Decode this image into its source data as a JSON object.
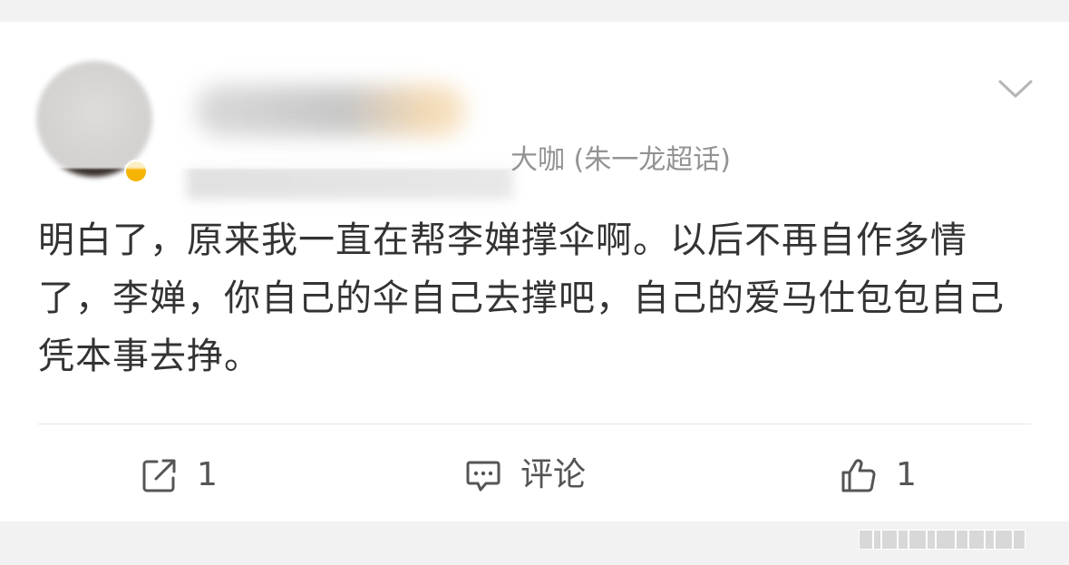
{
  "post": {
    "subtitle_visible": "大咖 (朱一龙超话)",
    "content": "明白了，原来我一直在帮李婵撑伞啊。以后不再自作多情了，李婵，你自己的伞自己去撑吧，自己的爱马仕包包自己凭本事去挣。"
  },
  "actions": {
    "repost_count": "1",
    "comment_label": "评论",
    "like_count": "1"
  },
  "icons": {
    "more": "chevron-down-icon",
    "repost": "repost-icon",
    "comment": "comment-icon",
    "like": "thumbs-up-icon"
  },
  "colors": {
    "background": "#f2f2f2",
    "card": "#ffffff",
    "text": "#333333",
    "secondary_text": "#939393",
    "divider": "#e6e6e6"
  }
}
